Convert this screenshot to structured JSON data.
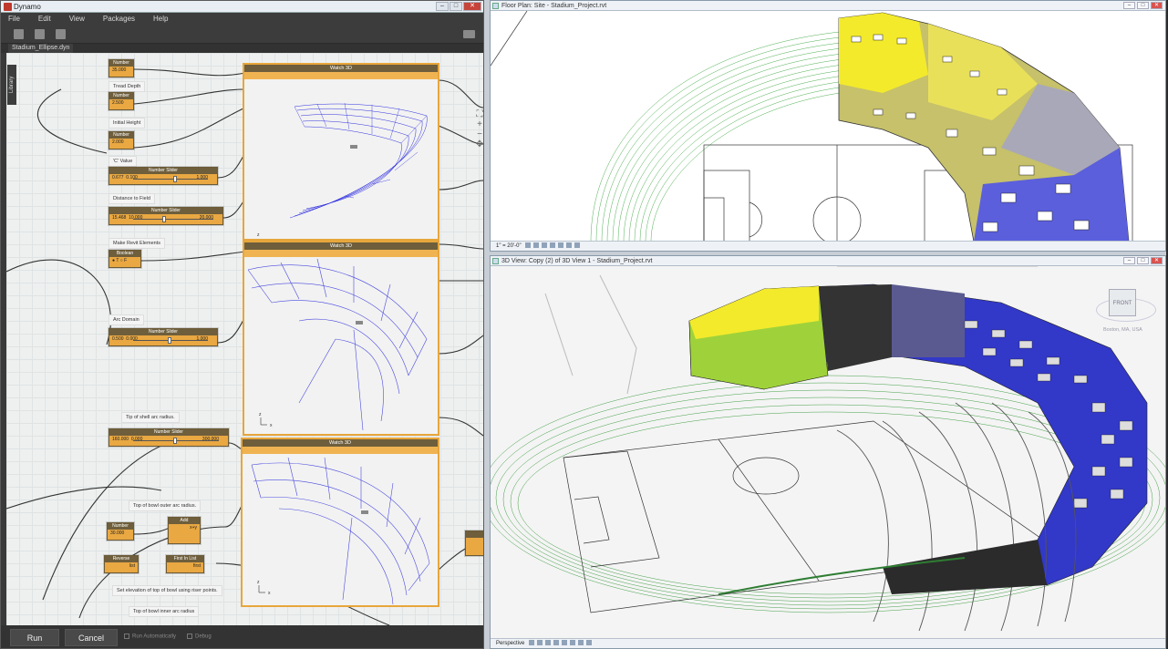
{
  "dynamo": {
    "title": "Dynamo",
    "menu": [
      "File",
      "Edit",
      "View",
      "Packages",
      "Help"
    ],
    "tab": "Stadium_Ellipse.dyn",
    "library_label": "Library",
    "nodes": {
      "number1": {
        "header": "Number",
        "value": "35.000"
      },
      "number2": {
        "header": "Number",
        "value": "2.500"
      },
      "number3": {
        "header": "Number",
        "value": "2.000"
      },
      "slider1": {
        "header": "Number Slider",
        "value": "0.677",
        "min": "0.100",
        "max": "1.000"
      },
      "slider2": {
        "header": "Number Slider",
        "value": "15.468",
        "min": "10.000",
        "max": "20.000"
      },
      "boolean": {
        "header": "Boolean",
        "value": "● T  ○ F"
      },
      "slider3": {
        "header": "Number Slider",
        "value": "0.500",
        "min": "0.000",
        "max": "1.000"
      },
      "slider4": {
        "header": "Number Slider",
        "value": "160.000",
        "min": "0.000",
        "max": "300.000"
      },
      "number4": {
        "header": "Number",
        "value": "30.000"
      },
      "add": {
        "header": "Add",
        "value": "x+y"
      },
      "reverse": {
        "header": "Reverse",
        "value": "list"
      },
      "first_in_list": {
        "header": "First In List",
        "value": "first"
      }
    },
    "notes": {
      "tread_depth": "Tread Depth",
      "initial_height": "Initial Height",
      "c_value": "'C' Value",
      "distance_to_field": "Distance to Field",
      "make_revit_elements": "Make Revit Elements",
      "arc_domain": "Arc Domain",
      "tip_of_shell": "Tip of shell arc radius.",
      "top_bowl_outer": "Top of bowl outer arc radius.",
      "set_elevation": "Set elevation of top of bowl using riser points.",
      "top_bowl_inner": "Top of bowl inner arc radius"
    },
    "watch": [
      "Watch 3D",
      "Watch 3D",
      "Watch 3D"
    ],
    "run_label": "Run",
    "cancel_label": "Cancel",
    "run_auto": "Run Automatically",
    "debug": "Debug"
  },
  "floor_plan": {
    "title": "Floor Plan: Site - Stadium_Project.rvt",
    "scale": "1\" = 20'-0\""
  },
  "view3d": {
    "title": "3D View: Copy (2) of 3D View 1 - Stadium_Project.rvt",
    "mode": "Perspective",
    "viewcube_label": "FRONT",
    "location": "Boston, MA, USA"
  },
  "colors": {
    "node": "#e9a842",
    "node_header": "#6e5e3c",
    "yellow": "#f3ea2c",
    "blue": "#3a3fd6",
    "field_green": "#2e9e3f"
  }
}
